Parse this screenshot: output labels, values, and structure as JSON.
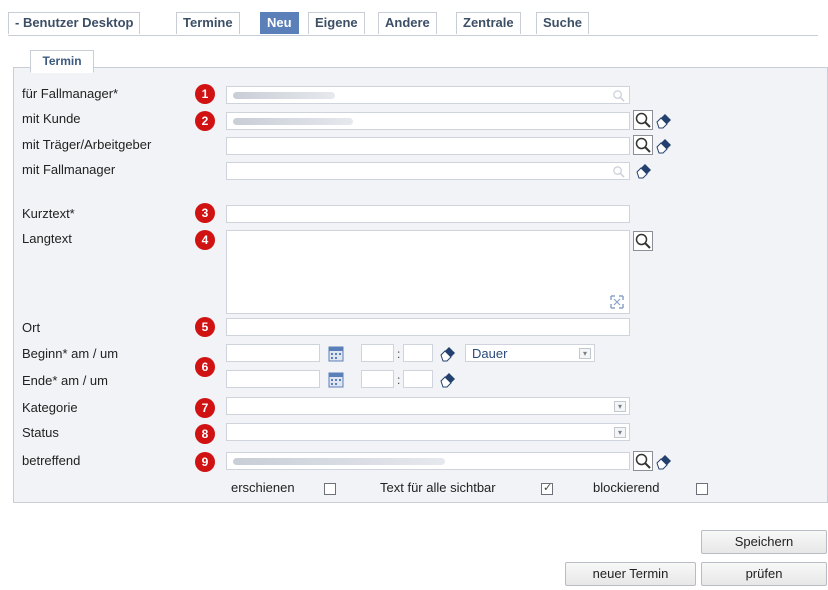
{
  "tabs": [
    {
      "label": "- Benutzer Desktop"
    },
    {
      "label": "Termine"
    },
    {
      "label": "Neu"
    },
    {
      "label": "Eigene"
    },
    {
      "label": "Andere"
    },
    {
      "label": "Zentrale"
    },
    {
      "label": "Suche"
    }
  ],
  "section": {
    "title": "Termin"
  },
  "fields": {
    "fallmanager_req": {
      "label": "für Fallmanager*",
      "badge": "1"
    },
    "kunde": {
      "label": "mit Kunde",
      "badge": "2"
    },
    "traeger": {
      "label": "mit Träger/Arbeitgeber"
    },
    "fallmanager": {
      "label": "mit Fallmanager"
    },
    "kurztext": {
      "label": "Kurztext*",
      "badge": "3"
    },
    "langtext": {
      "label": "Langtext",
      "badge": "4"
    },
    "ort": {
      "label": "Ort",
      "badge": "5"
    },
    "beginn": {
      "label": "Beginn* am / um",
      "dauer": "Dauer"
    },
    "ende": {
      "label": "Ende* am / um"
    },
    "time_badge": "6",
    "kategorie": {
      "label": "Kategorie",
      "badge": "7"
    },
    "status": {
      "label": "Status",
      "badge": "8"
    },
    "betreffend": {
      "label": "betreffend",
      "badge": "9"
    }
  },
  "options": {
    "erschienen": {
      "label": "erschienen",
      "checked": false
    },
    "sichtbar": {
      "label": "Text für alle sichtbar",
      "checked": true
    },
    "blockierend": {
      "label": "blockierend",
      "checked": false
    }
  },
  "buttons": {
    "speichern": "Speichern",
    "neuer_termin": "neuer Termin",
    "pruefen": "prüfen"
  }
}
